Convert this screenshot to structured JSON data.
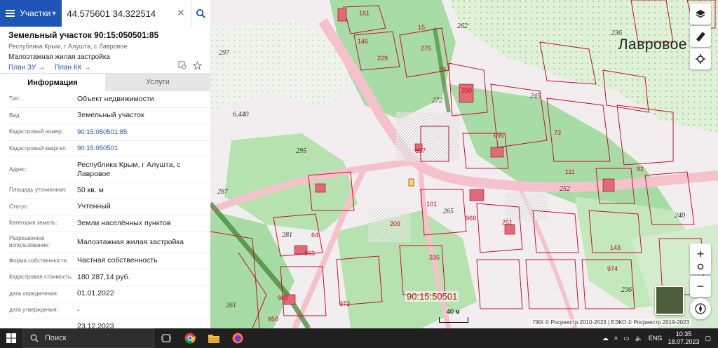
{
  "search": {
    "category": "Участки",
    "query": "44.575601 34.322514"
  },
  "object": {
    "title": "Земельный участок 90:15:050501:85",
    "address_short": "Республика Крым, г Алушта, с Лавровое",
    "usage_short": "Малоэтажная жилая застройка",
    "link_plan_zu": "План ЗУ",
    "link_plan_kk": "План КК"
  },
  "tabs": {
    "info": "Информация",
    "services": "Услуги"
  },
  "info_rows": [
    {
      "k": "Тип:",
      "v": "Объект недвижимости",
      "link": false
    },
    {
      "k": "Вид:",
      "v": "Земельный участок",
      "link": false
    },
    {
      "k": "Кадастровый номер:",
      "v": "90:15:050501:85",
      "link": true
    },
    {
      "k": "Кадастровый квартал:",
      "v": "90:15:050501",
      "link": true
    },
    {
      "k": "Адрес:",
      "v": "Республика Крым, г Алушта, с Лавровое",
      "link": false
    },
    {
      "k": "Площадь уточненная:",
      "v": "50 кв. м",
      "link": false
    },
    {
      "k": "Статус:",
      "v": "Учтенный",
      "link": false
    },
    {
      "k": "Категория земель:",
      "v": "Земли населённых пунктов",
      "link": false
    },
    {
      "k": "Разрешенное использование:",
      "v": "Малоэтажная жилая застройка",
      "link": false
    },
    {
      "k": "Форма собственности:",
      "v": "Частная собственность",
      "link": false
    },
    {
      "k": "Кадастровая стоимость:",
      "v": "180 287,14 руб.",
      "link": false
    },
    {
      "k": "дата определения:",
      "v": "01.01.2022",
      "link": false
    },
    {
      "k": "дата утверждения:",
      "v": "-",
      "link": false
    },
    {
      "k": "",
      "v": "23.12.2023",
      "link": false
    }
  ],
  "map": {
    "place_name": "Лавровое",
    "quarter_label": "90:15:50501",
    "scale": "40 м",
    "copyright": "ПКК © Росреестр 2010-2023 | ЕЭКО © Росреестр 2019-2023",
    "contour_labels": [
      "297",
      "262",
      "236",
      "245",
      "272",
      "6.440",
      "295",
      "287",
      "281",
      "252",
      "265",
      "261",
      "240",
      "236",
      "193",
      "256",
      "253",
      "333",
      "335"
    ],
    "parcel_labels": [
      "161",
      "15",
      "146",
      "229",
      "275",
      "59",
      "250",
      "73",
      "657",
      "695",
      "111",
      "92",
      "101",
      "968",
      "251",
      "209",
      "64",
      "962",
      "972",
      "950",
      "963",
      "143",
      "974",
      "335"
    ]
  },
  "taskbar": {
    "search_placeholder": "Поиск",
    "lang": "ENG",
    "time": "10:35",
    "date": "18.07.2023"
  },
  "colors": {
    "header": "#1e55b7",
    "parcel_border": "#c8102e",
    "green": "#9fd8a0",
    "road": "#f6c6cf"
  }
}
